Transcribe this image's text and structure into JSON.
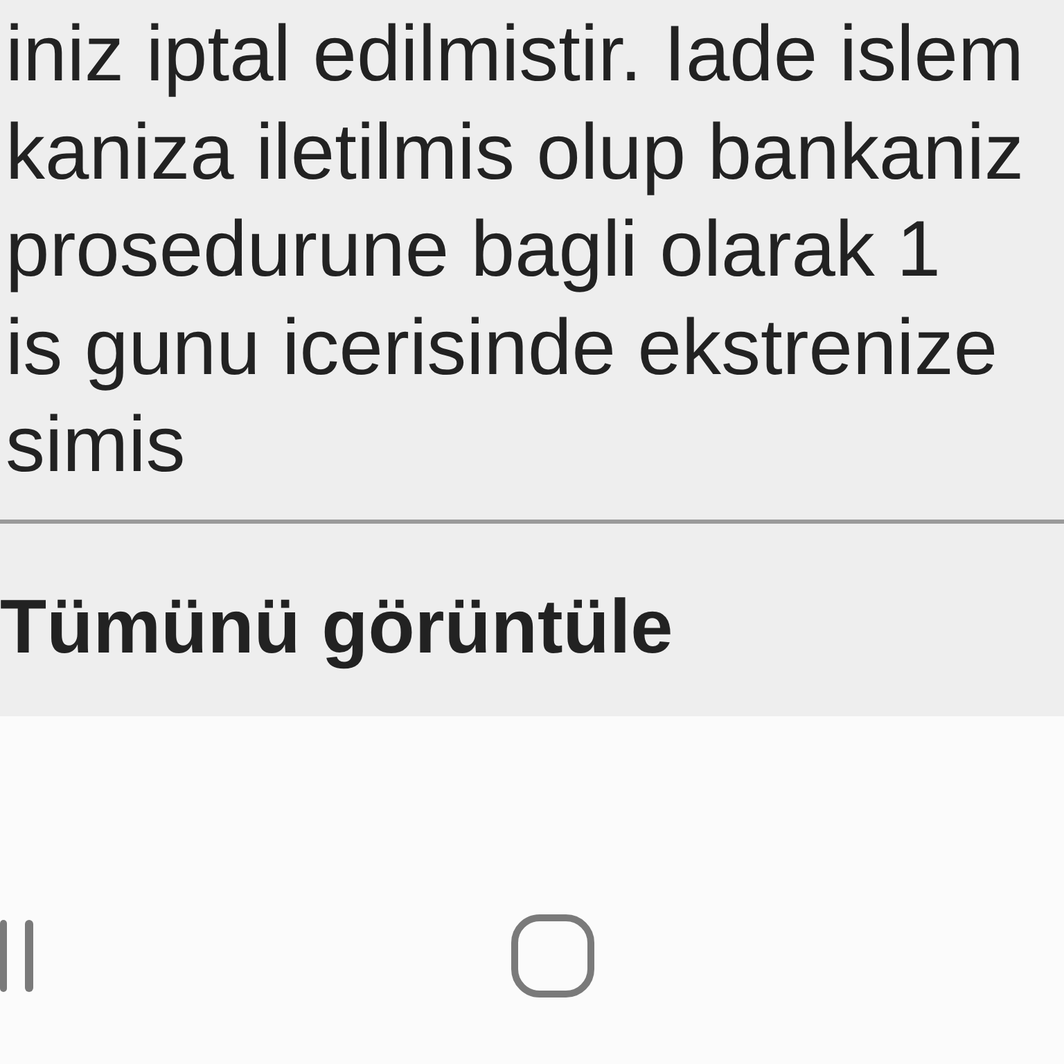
{
  "message": {
    "lines": [
      "iniz iptal edilmistir. Iade islem",
      "kaniza iletilmis olup bankaniz",
      "prosedurune bagli olarak 1",
      "is gunu icerisinde ekstrenize",
      "simis"
    ]
  },
  "view_all_link": {
    "label": "Tümünü görüntüle"
  }
}
